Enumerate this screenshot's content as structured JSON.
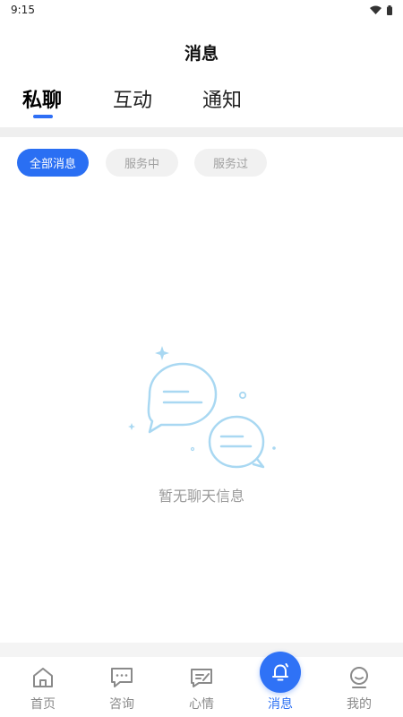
{
  "status_bar": {
    "time": "9:15",
    "wifi_icon": "wifi-icon",
    "battery_icon": "battery-icon"
  },
  "header": {
    "title": "消息"
  },
  "tabs": [
    {
      "label": "私聊",
      "active": true
    },
    {
      "label": "互动",
      "active": false
    },
    {
      "label": "通知",
      "active": false
    }
  ],
  "filters": [
    {
      "label": "全部消息",
      "active": true
    },
    {
      "label": "服务中",
      "active": false
    },
    {
      "label": "服务过",
      "active": false
    }
  ],
  "empty_state": {
    "icon": "chat-bubbles-icon",
    "text": "暂无聊天信息"
  },
  "bottom_nav": [
    {
      "label": "首页",
      "icon": "home-icon",
      "active": false
    },
    {
      "label": "咨询",
      "icon": "consult-chat-icon",
      "active": false
    },
    {
      "label": "心情",
      "icon": "mood-note-icon",
      "active": false
    },
    {
      "label": "消息",
      "icon": "bell-icon",
      "active": true
    },
    {
      "label": "我的",
      "icon": "profile-icon",
      "active": false
    }
  ],
  "colors": {
    "accent": "#2a6ff3",
    "chip_inactive_bg": "#f1f1f1",
    "muted_text": "#9a9a9a",
    "illustration": "#a9d8f2"
  }
}
